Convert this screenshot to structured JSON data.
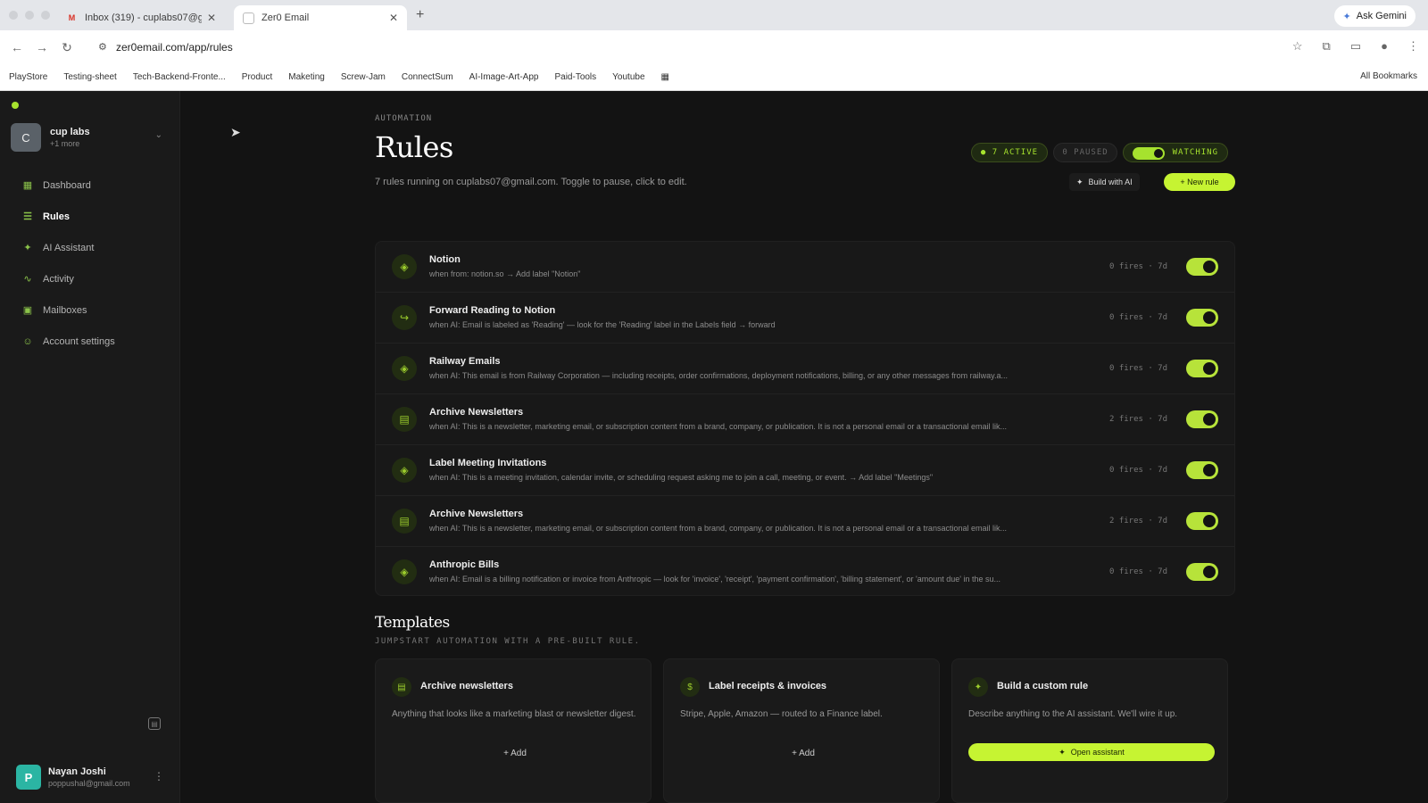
{
  "browser": {
    "tabs": [
      {
        "title": "Inbox (319) - cuplabs07@gm",
        "icon": "gmail-icon"
      },
      {
        "title": "Zer0 Email",
        "icon": "zero-email-icon"
      }
    ],
    "ask_gemini": "Ask Gemini",
    "url": "zer0email.com/app/rules",
    "bookmarks": [
      "PlayStore",
      "Testing-sheet",
      "Tech-Backend-Fronte...",
      "Product",
      "Maketing",
      "Screw-Jam",
      "ConnectSum",
      "AI-Image-Art-App",
      "Paid-Tools",
      "Youtube"
    ],
    "all_bookmarks": "All Bookmarks"
  },
  "sidebar": {
    "workspace": {
      "initial": "C",
      "name": "cup labs",
      "sub": "+1 more"
    },
    "nav": [
      {
        "label": "Dashboard",
        "icon": "grid-icon"
      },
      {
        "label": "Rules",
        "icon": "filter-icon",
        "selected": true
      },
      {
        "label": "AI Assistant",
        "icon": "sparkle-icon"
      },
      {
        "label": "Activity",
        "icon": "activity-icon"
      },
      {
        "label": "Mailboxes",
        "icon": "inbox-icon"
      },
      {
        "label": "Account settings",
        "icon": "user-settings-icon"
      }
    ],
    "user": {
      "initial": "P",
      "name": "Nayan Joshi",
      "email": "poppushal@gmail.com"
    }
  },
  "header": {
    "eyebrow": "AUTOMATION",
    "title": "Rules",
    "description": "7 rules running on cuplabs07@gmail.com. Toggle to pause, click to edit.",
    "active_pill": "● 7 ACTIVE",
    "paused_pill": "0 PAUSED",
    "watching_pill": "WATCHING",
    "build_ai": "Build with AI",
    "new_rule": "+ New rule"
  },
  "rules": [
    {
      "name": "Notion",
      "condition": "when from: notion.so → Add label \"Notion\"",
      "fires": "0 fires · 7d",
      "icon": "tag-icon",
      "enabled": true
    },
    {
      "name": "Forward Reading to Notion",
      "condition": "when AI: Email is labeled as 'Reading' — look for the 'Reading' label in the Labels field → forward",
      "fires": "0 fires · 7d",
      "icon": "forward-icon",
      "enabled": true
    },
    {
      "name": "Railway Emails",
      "condition": "when AI: This email is from Railway Corporation — including receipts, order confirmations, deployment notifications, billing, or any other messages from railway.a...",
      "fires": "0 fires · 7d",
      "icon": "tag-icon",
      "enabled": true
    },
    {
      "name": "Archive Newsletters",
      "condition": "when AI: This is a newsletter, marketing email, or subscription content from a brand, company, or publication. It is not a personal email or a transactional email lik...",
      "fires": "2 fires · 7d",
      "icon": "archive-icon",
      "enabled": true
    },
    {
      "name": "Label Meeting Invitations",
      "condition": "when AI: This is a meeting invitation, calendar invite, or scheduling request asking me to join a call, meeting, or event. → Add label \"Meetings\"",
      "fires": "0 fires · 7d",
      "icon": "tag-icon",
      "enabled": true
    },
    {
      "name": "Archive Newsletters",
      "condition": "when AI: This is a newsletter, marketing email, or subscription content from a brand, company, or publication. It is not a personal email or a transactional email lik...",
      "fires": "2 fires · 7d",
      "icon": "archive-icon",
      "enabled": true
    },
    {
      "name": "Anthropic Bills",
      "condition": "when AI: Email is a billing notification or invoice from Anthropic — look for 'invoice', 'receipt', 'payment confirmation', 'billing statement', or 'amount due' in the su...",
      "fires": "0 fires · 7d",
      "icon": "tag-icon",
      "enabled": true
    }
  ],
  "templates": {
    "title": "Templates",
    "subtitle": "JUMPSTART AUTOMATION WITH A PRE-BUILT RULE.",
    "cards": [
      {
        "title": "Archive newsletters",
        "desc": "Anything that looks like a marketing blast or newsletter digest.",
        "action": "+ Add",
        "icon": "archive-icon"
      },
      {
        "title": "Label receipts & invoices",
        "desc": "Stripe, Apple, Amazon — routed to a Finance label.",
        "action": "+ Add",
        "icon": "receipt-icon"
      },
      {
        "title": "Build a custom rule",
        "desc": "Describe anything to the AI assistant. We'll wire it up.",
        "action": "Open assistant",
        "icon": "sparkle-icon"
      }
    ]
  },
  "colors": {
    "accent": "#c6f432",
    "bg": "#131313",
    "sidebar": "#1a1a1a"
  }
}
